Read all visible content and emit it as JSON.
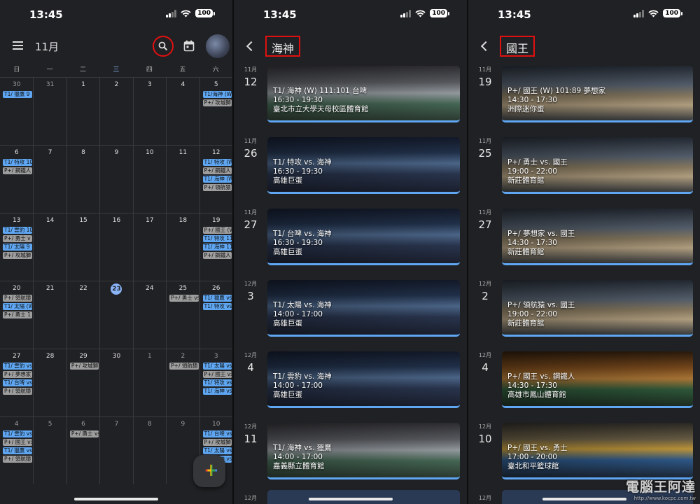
{
  "status": {
    "time": "13:45",
    "battery": "100"
  },
  "calendar": {
    "month": "11月",
    "weekdays": [
      "日",
      "一",
      "二",
      "三",
      "四",
      "五",
      "六"
    ],
    "today_index": 3,
    "weeks": [
      {
        "days": [
          {
            "d": "30",
            "dim": true,
            "ev": [
              [
                "T1/ 獵鷹 9",
                "b"
              ]
            ]
          },
          {
            "d": "31",
            "dim": true,
            "ev": []
          },
          {
            "d": "1",
            "ev": []
          },
          {
            "d": "2",
            "ev": []
          },
          {
            "d": "3",
            "ev": []
          },
          {
            "d": "4",
            "ev": []
          },
          {
            "d": "5",
            "ev": [
              [
                "T1/海神 (W)",
                "b"
              ],
              [
                "P+/ 攻城獅",
                "g"
              ]
            ]
          }
        ]
      },
      {
        "days": [
          {
            "d": "6",
            "ev": [
              [
                "T1/ 特攻 10",
                "b"
              ],
              [
                "P+/ 鋼鐵人",
                "g"
              ]
            ]
          },
          {
            "d": "7",
            "ev": []
          },
          {
            "d": "8",
            "ev": []
          },
          {
            "d": "9",
            "ev": []
          },
          {
            "d": "10",
            "ev": []
          },
          {
            "d": "11",
            "ev": []
          },
          {
            "d": "12",
            "ev": [
              [
                "T1/ 特攻 (W",
                "b"
              ],
              [
                "P+/ 鋼鐵人",
                "g"
              ],
              [
                "T1/ 海神 (W",
                "b"
              ],
              [
                "P+/ 領航猿",
                "g"
              ]
            ]
          }
        ]
      },
      {
        "days": [
          {
            "d": "13",
            "ev": [
              [
                "T1/ 雲豹 10",
                "b"
              ],
              [
                "P+/ 勇士 v",
                "g"
              ],
              [
                "T1/ 太陽 9",
                "b"
              ],
              [
                "P+/ 攻城獅",
                "g"
              ]
            ]
          },
          {
            "d": "14",
            "ev": []
          },
          {
            "d": "15",
            "ev": []
          },
          {
            "d": "16",
            "ev": []
          },
          {
            "d": "17",
            "ev": []
          },
          {
            "d": "18",
            "ev": []
          },
          {
            "d": "19",
            "ev": [
              [
                "P+/ 國王 (W",
                "g"
              ],
              [
                "T1/ 特攻 11",
                "b"
              ],
              [
                "T1/ 海神 11",
                "b"
              ],
              [
                "P+/ 鋼鐵人 9",
                "g"
              ]
            ]
          }
        ]
      },
      {
        "days": [
          {
            "d": "20",
            "ev": [
              [
                "P+/ 領航猿",
                "g"
              ],
              [
                "T1/ 太陽 (W",
                "b"
              ],
              [
                "P+/ 勇士 1",
                "g"
              ]
            ]
          },
          {
            "d": "21",
            "ev": []
          },
          {
            "d": "22",
            "ev": []
          },
          {
            "d": "23",
            "today": true,
            "ev": []
          },
          {
            "d": "24",
            "ev": []
          },
          {
            "d": "25",
            "ev": [
              [
                "P+/ 勇士 vs",
                "g"
              ]
            ]
          },
          {
            "d": "26",
            "ev": [
              [
                "T1/ 獵鷹 vs",
                "b"
              ],
              [
                "T1/ 特攻 vs",
                "b"
              ]
            ]
          }
        ]
      },
      {
        "days": [
          {
            "d": "27",
            "ev": [
              [
                "T1/ 雲豹 vs",
                "b"
              ],
              [
                "P+/ 夢想家",
                "g"
              ],
              [
                "T1/ 台啤 vs",
                "b"
              ],
              [
                "P+/ 領航猿",
                "g"
              ]
            ]
          },
          {
            "d": "28",
            "ev": []
          },
          {
            "d": "29",
            "ev": [
              [
                "P+/ 攻城獅",
                "g"
              ]
            ]
          },
          {
            "d": "30",
            "ev": []
          },
          {
            "d": "1",
            "dim": true,
            "ev": []
          },
          {
            "d": "2",
            "dim": true,
            "ev": [
              [
                "P+/ 領航猿",
                "g"
              ]
            ]
          },
          {
            "d": "3",
            "dim": true,
            "ev": [
              [
                "T1/ 太陽 vs",
                "b"
              ],
              [
                "P+/ 國王 vs",
                "g"
              ],
              [
                "T1/ 特攻 vs",
                "b"
              ],
              [
                "T1/ 海神 vs",
                "b"
              ]
            ]
          }
        ]
      },
      {
        "days": [
          {
            "d": "4",
            "dim": true,
            "ev": [
              [
                "T1/ 雲豹 vs",
                "b"
              ],
              [
                "P+/ 國王 vs",
                "g"
              ],
              [
                "T1/ 獵鷹 vs",
                "b"
              ],
              [
                "P+/ 領航猿",
                "g"
              ]
            ]
          },
          {
            "d": "5",
            "dim": true,
            "ev": []
          },
          {
            "d": "6",
            "dim": true,
            "ev": [
              [
                "P+/ 勇士 vs",
                "g"
              ]
            ]
          },
          {
            "d": "7",
            "dim": true,
            "ev": []
          },
          {
            "d": "8",
            "dim": true,
            "ev": []
          },
          {
            "d": "9",
            "dim": true,
            "ev": []
          },
          {
            "d": "10",
            "dim": true,
            "ev": [
              [
                "T1/ 台啤 vs",
                "b"
              ],
              [
                "P+/ 攻城獅",
                "g"
              ],
              [
                "T1/ 太陽 vs",
                "b"
              ],
              [
                "T1/ 海神 vs",
                "b"
              ]
            ]
          }
        ]
      }
    ]
  },
  "search1": {
    "query": "海神",
    "results": [
      {
        "month": "11月",
        "day": "12",
        "title": "T1/ 海神 (W) 111:101 台啤",
        "time": "16:30 - 19:30",
        "venue": "臺北市立大學天母校區體育館",
        "style": "gym"
      },
      {
        "month": "11月",
        "day": "26",
        "title": "T1/ 特攻 vs. 海神",
        "time": "16:30 - 19:30",
        "venue": "高雄巨蛋",
        "style": "arena"
      },
      {
        "month": "11月",
        "day": "27",
        "title": "T1/ 台啤 vs. 海神",
        "time": "16:30 - 19:30",
        "venue": "高雄巨蛋",
        "style": "arena"
      },
      {
        "month": "12月",
        "day": "3",
        "title": "T1/ 太陽 vs. 海神",
        "time": "14:00 - 17:00",
        "venue": "高雄巨蛋",
        "style": "arena"
      },
      {
        "month": "12月",
        "day": "4",
        "title": "T1/ 雲豹 vs. 海神",
        "time": "14:00 - 17:00",
        "venue": "高雄巨蛋",
        "style": "arena"
      },
      {
        "month": "12月",
        "day": "11",
        "title": "T1/ 海神 vs. 獵鷹",
        "time": "14:00 - 17:00",
        "venue": "嘉義縣立體育館",
        "style": "gym"
      }
    ],
    "next_month": "12月"
  },
  "search2": {
    "query": "國王",
    "results": [
      {
        "month": "11月",
        "day": "19",
        "title": "P+/ 國王 (W) 101:89 夢想家",
        "time": "14:30 - 17:30",
        "venue": "洲際迷你蛋",
        "style": "court"
      },
      {
        "month": "11月",
        "day": "25",
        "title": "P+/ 勇士 vs. 國王",
        "time": "19:00 - 22:00",
        "venue": "新莊體育館",
        "style": "court"
      },
      {
        "month": "11月",
        "day": "27",
        "title": "P+/ 夢想家 vs. 國王",
        "time": "14:30 - 17:30",
        "venue": "新莊體育館",
        "style": "court"
      },
      {
        "month": "12月",
        "day": "2",
        "title": "P+/ 領航猿 vs. 國王",
        "time": "19:00 - 22:00",
        "venue": "新莊體育館",
        "style": "court"
      },
      {
        "month": "12月",
        "day": "4",
        "title": "P+/ 國王 vs. 鋼鐵人",
        "time": "14:30 - 17:30",
        "venue": "高雄市鳳山體育館",
        "style": "wood"
      },
      {
        "month": "12月",
        "day": "10",
        "title": "P+/ 國王 vs. 勇士",
        "time": "17:00 - 20:00",
        "venue": "臺北和平籃球館",
        "style": "hall"
      }
    ],
    "next_month": "12月"
  },
  "watermark": {
    "text": "電腦王阿達",
    "url": "http://www.kocpc.com.tw"
  }
}
